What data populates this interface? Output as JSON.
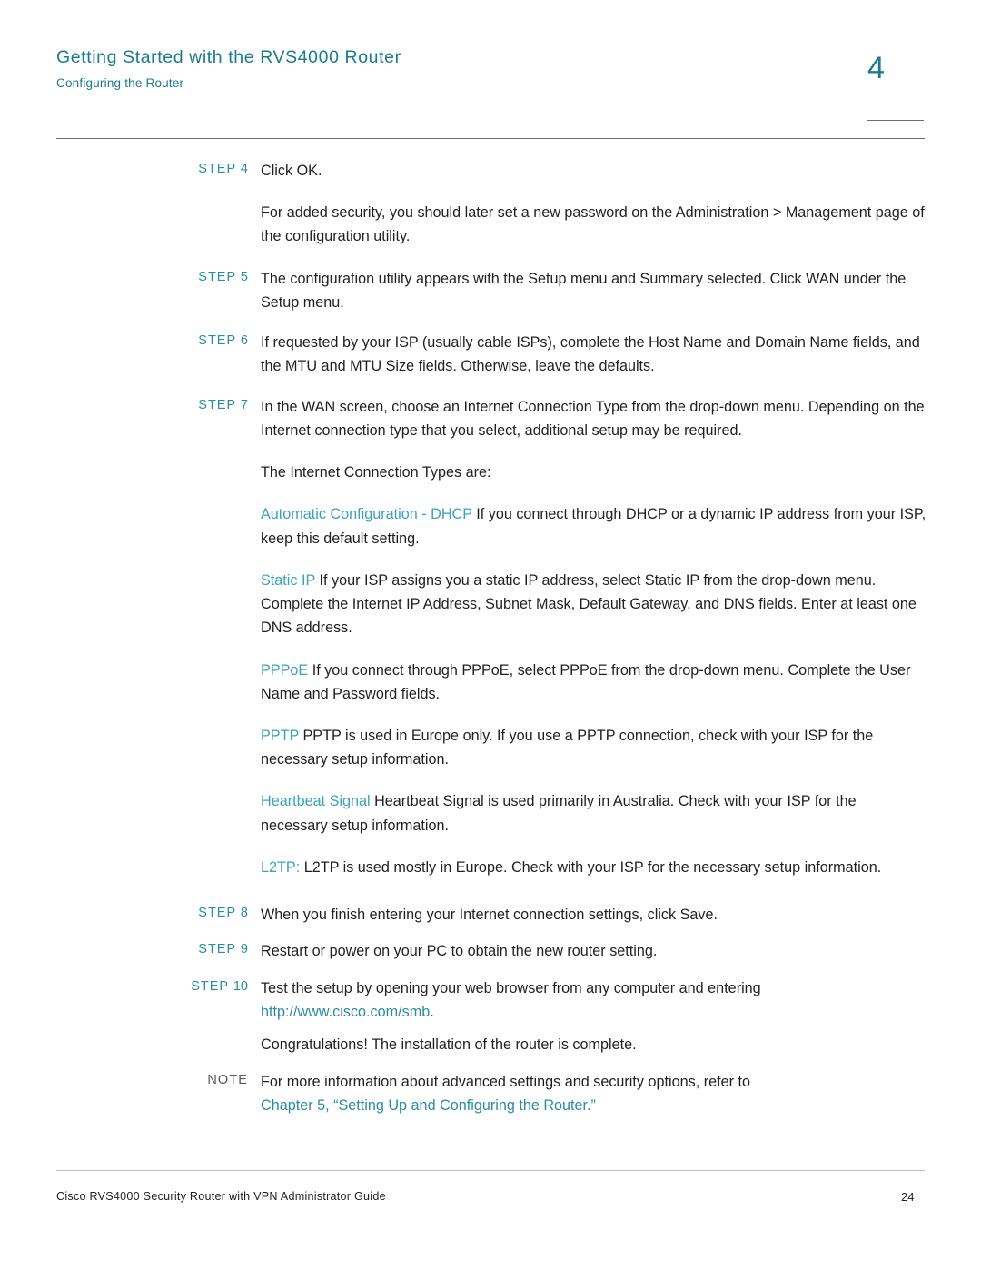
{
  "header": {
    "title": "Getting Started with the RVS4000 Router",
    "subtitle": "Configuring the Router",
    "chapter_number": "4"
  },
  "colors": {
    "heading_teal": "#1b7b8c",
    "step_teal": "#2a8ca3",
    "term_teal": "#3ba2bd",
    "body_text": "#231f20",
    "rule_gray": "#6d6e71",
    "rule_light": "#bcbec0"
  },
  "steps": [
    {
      "label": "STEP",
      "number": "4",
      "text": "Click OK."
    },
    {
      "label": "STEP",
      "number": "5",
      "text": "The configuration utility appears with the Setup menu and Summary selected. Click WAN under the Setup menu."
    },
    {
      "label": "STEP",
      "number": "6",
      "text": "If requested by your ISP (usually cable ISPs), complete the Host Name and Domain Name fields, and the MTU and MTU Size fields. Otherwise, leave the defaults."
    },
    {
      "label": "STEP",
      "number": "7",
      "text": "In the WAN screen, choose an Internet Connection Type from the drop-down menu. Depending on the Internet connection type that you select, additional setup may be required."
    },
    {
      "label": "STEP",
      "number": "8",
      "text": "When you finish entering your Internet connection settings, click Save."
    },
    {
      "label": "STEP",
      "number": "9",
      "text": "Restart or power on your PC to obtain the new router setting."
    },
    {
      "label": "STEP",
      "number": "10",
      "text": "Test the setup by opening your web browser from any computer and entering"
    }
  ],
  "body": {
    "step4_followup": "For added security, you should later set a new password on the Administration > Management page of the configuration utility.",
    "types_intro": "The Internet Connection Types are:",
    "step10_link": "http://www.cisco.com/smb",
    "step10_link_trail": ".",
    "congrats": "Congratulations! The installation of the router is complete."
  },
  "connection_types": [
    {
      "term": "Automatic Configuration - DHCP",
      "description": "If you connect through DHCP or a dynamic IP address from your ISP, keep this default setting."
    },
    {
      "term": "Static IP",
      "description": "If your ISP assigns you a static IP address, select Static IP from the drop-down menu. Complete the Internet IP Address, Subnet Mask, Default Gateway, and DNS fields. Enter at least one DNS address."
    },
    {
      "term": "PPPoE",
      "description": "If you connect through PPPoE, select PPPoE from the drop-down menu. Complete the User Name and Password fields."
    },
    {
      "term": "PPTP",
      "description": "PPTP is used in Europe only. If you use a PPTP connection, check with your ISP for the necessary setup information."
    },
    {
      "term": "Heartbeat Signal",
      "description": "Heartbeat Signal is used primarily in Australia. Check with your ISP for the necessary setup information."
    },
    {
      "term": "L2TP:",
      "description": "L2TP is used mostly in Europe. Check with your ISP for the necessary setup information."
    }
  ],
  "note": {
    "label": "NOTE",
    "text": "For more information about advanced settings and security options, refer to",
    "link": "Chapter 5, “Setting Up and Configuring the Router.”"
  },
  "footer": {
    "left": "Cisco RVS4000 Security Router with VPN Administrator Guide",
    "page": "24"
  }
}
